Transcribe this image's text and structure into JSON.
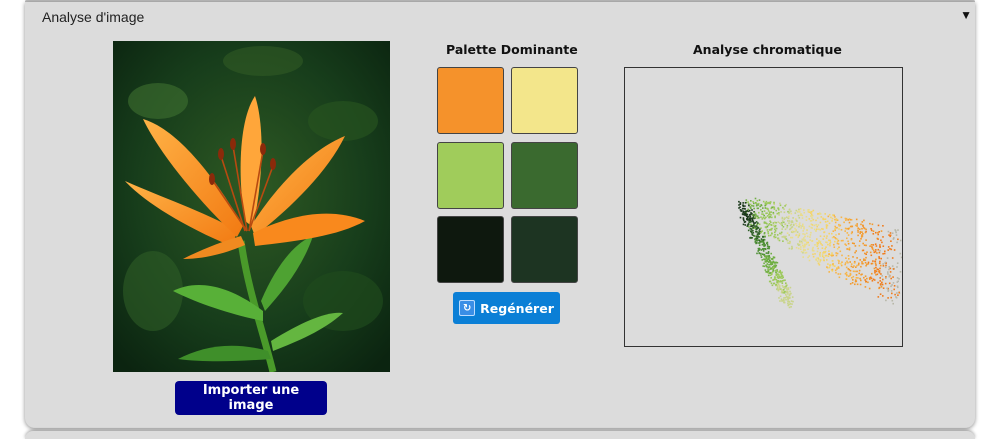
{
  "panel": {
    "title": "Analyse d'image",
    "toggle_icon": "triangle-down-icon"
  },
  "image_column": {
    "photo_description_icon": "orange-lily-photo",
    "import_label": "Importer une image"
  },
  "palette": {
    "title": "Palette Dominante",
    "swatches": [
      {
        "color": "#f5922b"
      },
      {
        "color": "#f3e68b"
      },
      {
        "color": "#a0cc5b"
      },
      {
        "color": "#3a6a2f"
      },
      {
        "color": "#0e180e"
      },
      {
        "color": "#1d3422"
      }
    ],
    "regen_icon": "refresh-icon",
    "regen_label": "Regénérer"
  },
  "chroma": {
    "title": "Analyse chromatique"
  }
}
